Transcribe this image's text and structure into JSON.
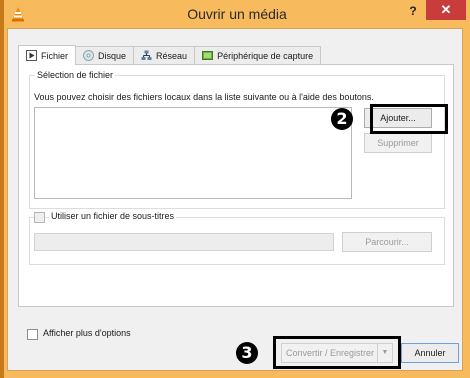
{
  "window": {
    "title": "Ouvrir un média",
    "help_label": "?",
    "close_label": "✕"
  },
  "tabs": [
    {
      "label": "Fichier",
      "icon": "play-file-icon",
      "active": true
    },
    {
      "label": "Disque",
      "icon": "disc-icon",
      "active": false
    },
    {
      "label": "Réseau",
      "icon": "network-icon",
      "active": false
    },
    {
      "label": "Périphérique de capture",
      "icon": "capture-device-icon",
      "active": false
    }
  ],
  "file_selection": {
    "group_label": "Sélection de fichier",
    "instruction": "Vous pouvez choisir des fichiers locaux dans la liste suivante ou à l'aide des boutons.",
    "add_label": "Ajouter...",
    "remove_label": "Supprimer"
  },
  "subtitles": {
    "checkbox_label": "Utiliser un fichier de sous-titres",
    "checked": false,
    "browse_label": "Parcourir..."
  },
  "more_options": {
    "label": "Afficher plus d'options",
    "checked": false
  },
  "footer": {
    "convert_label": "Convertir / Enregistrer",
    "convert_arrow": "▼",
    "cancel_label": "Annuler"
  },
  "annotations": {
    "step_add": "2",
    "step_convert": "3"
  },
  "colors": {
    "titlebar": "#f7ba5c",
    "close_button": "#c83c3c",
    "highlight": "#000000"
  }
}
